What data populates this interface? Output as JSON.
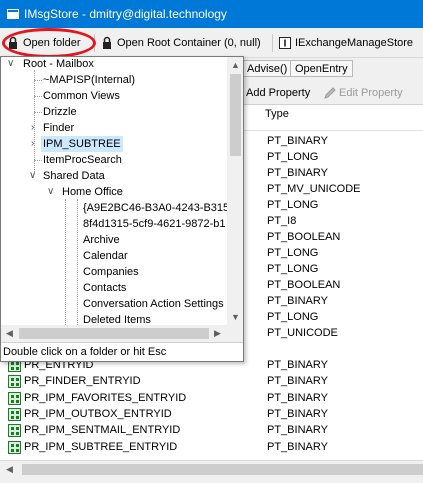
{
  "window": {
    "title": "IMsgStore - dmitry@digital.technology"
  },
  "toolbar": {
    "open_folder": "Open folder",
    "open_root": "Open Root Container (0, null)",
    "exchange_manage": "IExchangeManageStore"
  },
  "subtabs": [
    "Advise()",
    "OpenEntry"
  ],
  "prop_toolbar": {
    "add": "Add Property",
    "edit": "Edit Property"
  },
  "grid": {
    "type_header": "Type",
    "types": [
      "PT_BINARY",
      "PT_LONG",
      "PT_BINARY",
      "PT_MV_UNICODE",
      "PT_LONG",
      "PT_I8",
      "PT_BOOLEAN",
      "PT_LONG",
      "PT_LONG",
      "PT_BOOLEAN",
      "PT_BINARY",
      "PT_LONG",
      "PT_UNICODE"
    ],
    "rows": [
      {
        "name": "PR_ENTRYID",
        "type": "PT_BINARY"
      },
      {
        "name": "PR_FINDER_ENTRYID",
        "type": "PT_BINARY"
      },
      {
        "name": "PR_IPM_FAVORITES_ENTRYID",
        "type": "PT_BINARY"
      },
      {
        "name": "PR_IPM_OUTBOX_ENTRYID",
        "type": "PT_BINARY"
      },
      {
        "name": "PR_IPM_SENTMAIL_ENTRYID",
        "type": "PT_BINARY"
      },
      {
        "name": "PR_IPM_SUBTREE_ENTRYID",
        "type": "PT_BINARY"
      }
    ]
  },
  "tree": {
    "root": "Root - Mailbox",
    "level1": [
      "~MAPISP(Internal)",
      "Common Views",
      "Drizzle",
      "Finder",
      "IPM_SUBTREE",
      "ItemProcSearch",
      "Shared Data"
    ],
    "home_office": "Home Office",
    "level3": [
      "{A9E2BC46-B3A0-4243-B315-",
      "8f4d1315-5cf9-4621-9872-b1",
      "Archive",
      "Calendar",
      "Companies",
      "Contacts",
      "Conversation Action Settings",
      "Deleted Items"
    ],
    "hint": "Double click on a folder or hit Esc"
  }
}
